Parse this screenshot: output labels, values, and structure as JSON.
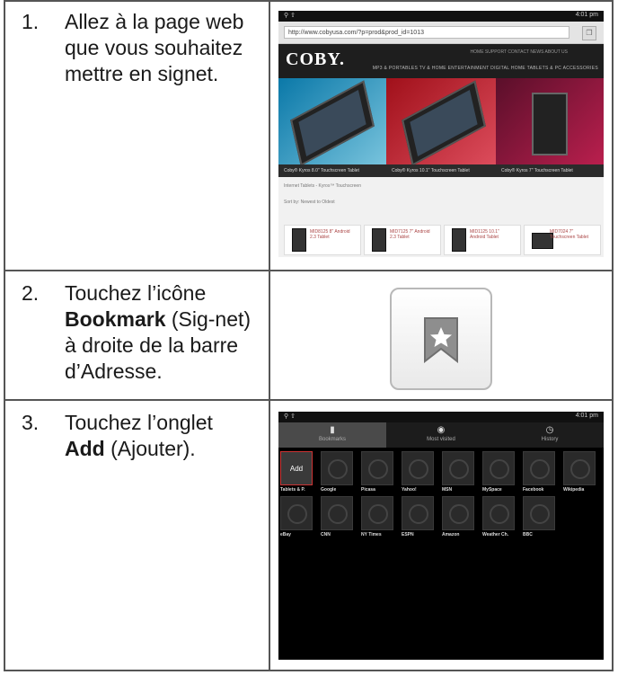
{
  "steps": [
    {
      "num": "1.",
      "text_before": "Allez à la page web que vous souhaitez mettre en signet.",
      "bold": "",
      "text_after": ""
    },
    {
      "num": "2.",
      "text_before": "Touchez l’icône ",
      "bold": "Bookmark",
      "text_after": " (Sig-net) à droite de la barre d’Adresse."
    },
    {
      "num": "3.",
      "text_before": "Touchez l’onglet ",
      "bold": "Add",
      "text_after": " (Ajouter)."
    }
  ],
  "screen1": {
    "time": "4:01 pm",
    "url": "http://www.cobyusa.com/?p=prod&prod_id=1013",
    "logo": "COBY.",
    "top_links": "HOME  SUPPORT  CONTACT  NEWS  ABOUT US",
    "nav": "MP3 & PORTABLES   TV & HOME ENTERTAINMENT   DIGITAL HOME   TABLETS & PC   ACCESSORIES",
    "captions": [
      "Coby® Kyros 8.0\" Touchscreen Tablet",
      "Coby® Kyros 10.1\" Touchscreen Tablet",
      "Coby® Kyros 7\" Touchscreen Tablet"
    ],
    "filter1": "Internet Tablets - Kyros™ Touchscreen",
    "filter2": "Sort by: Newest to Oldest",
    "products": [
      "MID8125 8\" Android 2.3 Tablet",
      "MID7125 7\" Android 2.3 Tablet",
      "MID1125 10.1\" Android Tablet",
      "MID7024 7\" Touchscreen Tablet"
    ]
  },
  "screen3": {
    "time": "4:01 pm",
    "tabs": [
      "Bookmarks",
      "Most visited",
      "History"
    ],
    "add_label": "Add",
    "row1": [
      "Tablets & P.",
      "Google",
      "Picasa",
      "Yahoo!",
      "MSN",
      "MySpace",
      "Facebook",
      "Wikipedia"
    ],
    "row2": [
      "eBay",
      "CNN",
      "NY Times",
      "ESPN",
      "Amazon",
      "Weather Ch.",
      "BBC"
    ]
  },
  "colors": {
    "border": "#555555",
    "text": "#1a1a1a",
    "icon_fill": "#8a8a8a"
  }
}
